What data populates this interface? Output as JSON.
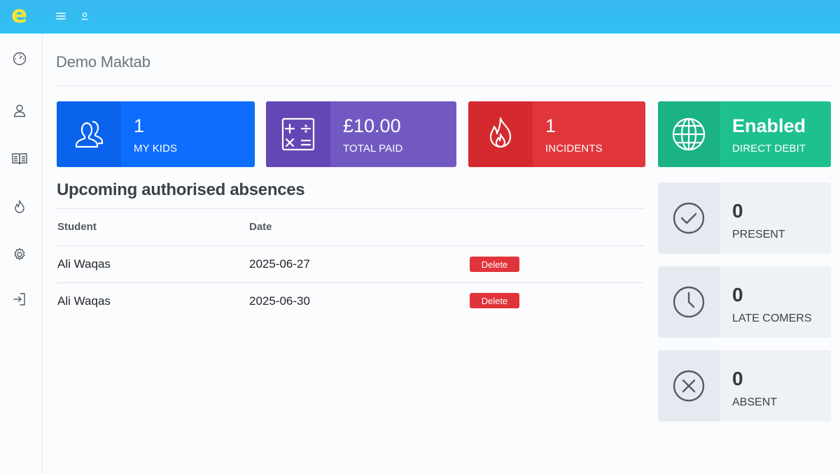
{
  "header": {
    "logo_text": "e",
    "menu_icon": "hamburger-menu-icon",
    "user_icon": "user-icon"
  },
  "sidebar": {
    "items": [
      {
        "icon": "dashboard-gauge-icon"
      },
      {
        "icon": "user-icon"
      },
      {
        "icon": "book-icon"
      },
      {
        "icon": "fire-icon"
      },
      {
        "icon": "settings-gear-icon"
      },
      {
        "icon": "sign-out-icon"
      }
    ]
  },
  "page": {
    "title": "Demo Maktab"
  },
  "stats": [
    {
      "value": "1",
      "label": "MY KIDS",
      "icon": "users-icon",
      "color": "#0d6efd"
    },
    {
      "value": "£10.00",
      "label": "TOTAL PAID",
      "icon": "calculator-icon",
      "color": "#7259c2"
    },
    {
      "value": "1",
      "label": "INCIDENTS",
      "icon": "fire-icon",
      "color": "#e0353b"
    },
    {
      "value": "Enabled",
      "label": "DIRECT DEBIT",
      "icon": "globe-icon",
      "color": "#1ec08e"
    }
  ],
  "attendance": [
    {
      "value": "0",
      "label": "PRESENT",
      "icon": "check-circle-icon"
    },
    {
      "value": "0",
      "label": "LATE COMERS",
      "icon": "clock-icon"
    },
    {
      "value": "0",
      "label": "ABSENT",
      "icon": "x-circle-icon"
    }
  ],
  "absences": {
    "title": "Upcoming authorised absences",
    "columns": [
      "Student",
      "Date"
    ],
    "rows": [
      {
        "student": "Ali Waqas",
        "date": "2025-06-27",
        "action": "Delete"
      },
      {
        "student": "Ali Waqas",
        "date": "2025-06-30",
        "action": "Delete"
      }
    ]
  }
}
